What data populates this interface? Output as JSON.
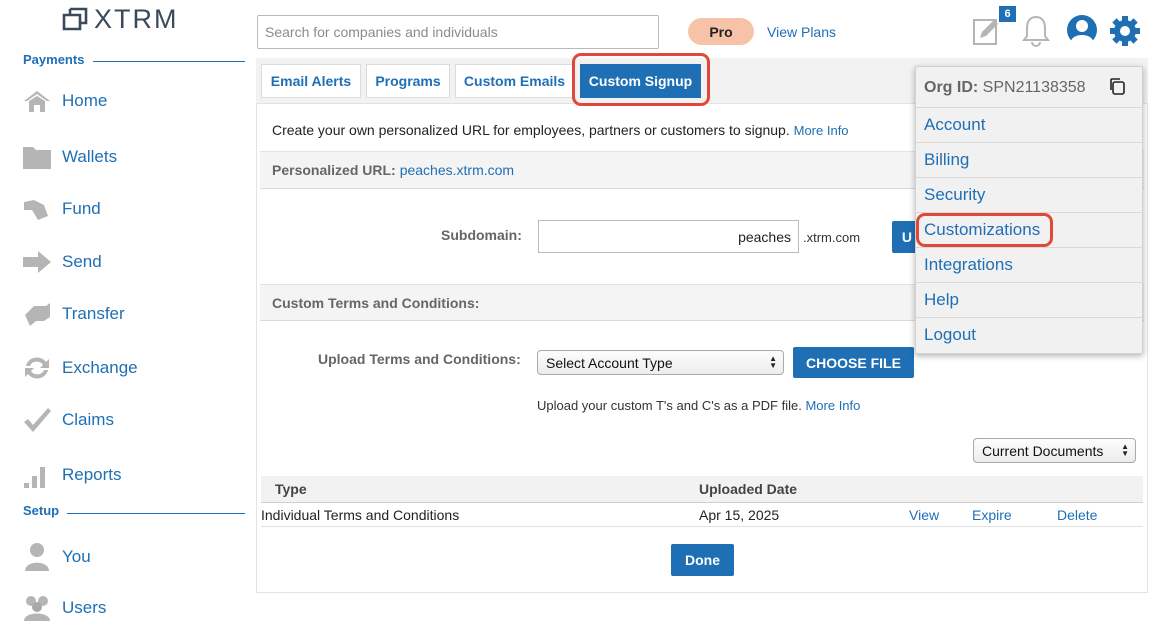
{
  "app": {
    "logo_text": "XTRM"
  },
  "sidebar": {
    "payments_label": "Payments",
    "setup_label": "Setup",
    "payments_items": [
      {
        "label": "Home",
        "icon": "home-icon"
      },
      {
        "label": "Wallets",
        "icon": "folder-icon"
      },
      {
        "label": "Fund",
        "icon": "fund-icon"
      },
      {
        "label": "Send",
        "icon": "arrow-right-icon"
      },
      {
        "label": "Transfer",
        "icon": "transfer-icon"
      },
      {
        "label": "Exchange",
        "icon": "exchange-icon"
      },
      {
        "label": "Claims",
        "icon": "checkmark-icon"
      },
      {
        "label": "Reports",
        "icon": "bar-chart-icon"
      }
    ],
    "setup_items": [
      {
        "label": "You",
        "icon": "user-icon"
      },
      {
        "label": "Users",
        "icon": "users-icon"
      }
    ]
  },
  "header": {
    "search_placeholder": "Search for companies and individuals",
    "plan_badge": "Pro",
    "view_plans": "View Plans",
    "notification_count": "6"
  },
  "tabs": [
    {
      "label": "Email Alerts",
      "active": false
    },
    {
      "label": "Programs",
      "active": false
    },
    {
      "label": "Custom Emails",
      "active": false
    },
    {
      "label": "Custom Signup",
      "active": true
    }
  ],
  "content": {
    "intro_text": "Create your own personalized URL for employees, partners or customers to signup.",
    "more_info": "More Info",
    "personalized_url_label": "Personalized URL:",
    "personalized_url_value": "peaches.xtrm.com",
    "subdomain_label": "Subdomain:",
    "subdomain_value": "peaches",
    "subdomain_suffix": ".xtrm.com",
    "update_button_partial": "U",
    "terms_section_label": "Custom Terms and Conditions:",
    "upload_terms_label": "Upload Terms and Conditions:",
    "account_type_select": "Select Account Type",
    "choose_file_button": "CHOOSE FILE",
    "upload_note": "Upload your custom T's and C's as a PDF file.",
    "upload_more_info": "More Info",
    "documents_filter": "Current Documents",
    "done_button": "Done"
  },
  "documents_table": {
    "columns": [
      "Type",
      "Uploaded Date"
    ],
    "rows": [
      {
        "type": "Individual Terms and Conditions",
        "date": "Apr 15, 2025",
        "actions": [
          "View",
          "Expire",
          "Delete"
        ]
      }
    ]
  },
  "account_menu": {
    "org_id_label": "Org ID:",
    "org_id_value": "SPN21138358",
    "items": [
      "Account",
      "Billing",
      "Security",
      "Customizations",
      "Integrations",
      "Help",
      "Logout"
    ]
  },
  "colors": {
    "accent": "#1f6fb5",
    "highlight": "#e0493a",
    "pro_badge": "#f7c3a8"
  }
}
